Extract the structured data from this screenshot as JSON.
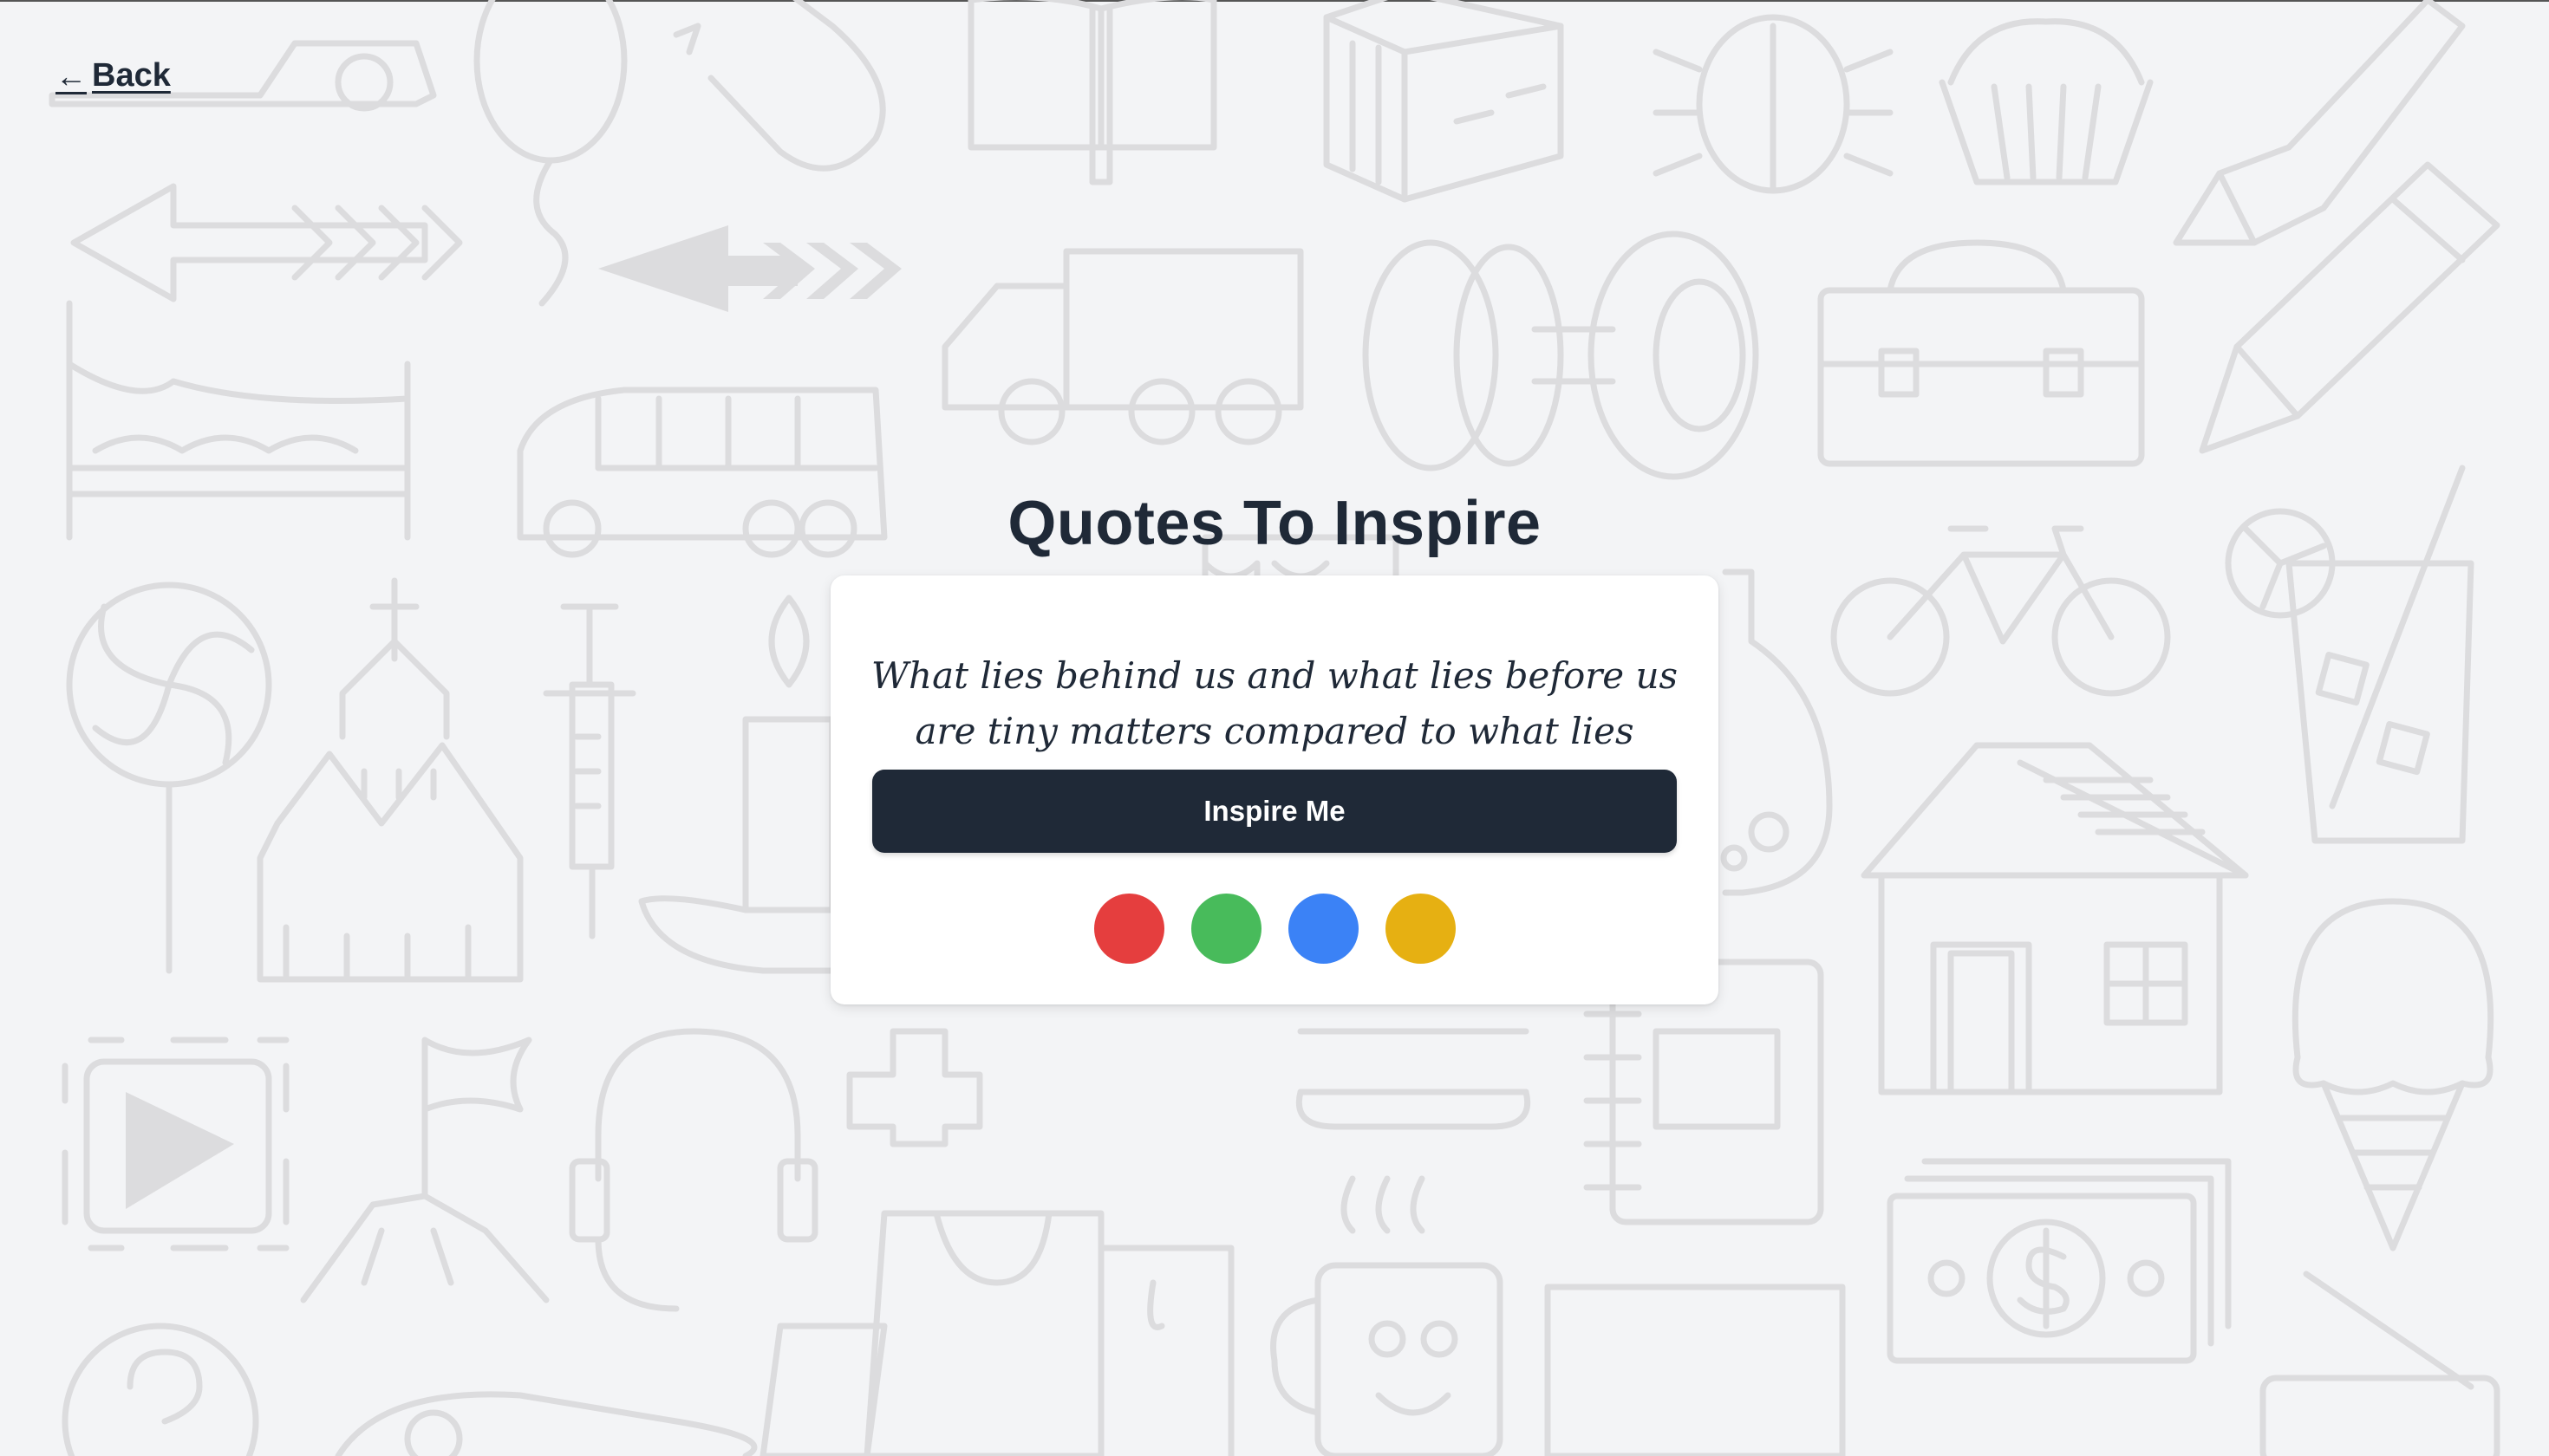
{
  "nav": {
    "back_label": "Back",
    "back_icon": "arrow-left-icon"
  },
  "page": {
    "title": "Quotes To Inspire"
  },
  "quote": {
    "text": "What lies behind us and what lies before us are tiny matters compared to what lies within us."
  },
  "actions": {
    "inspire_label": "Inspire Me"
  },
  "colors": {
    "background": "#f3f4f6",
    "doodle_stroke": "#dcdcde",
    "text": "#1f2937",
    "button": "#1f2937",
    "swatches": [
      "#e53e3e",
      "#48bb5b",
      "#3b82f6",
      "#e6b012"
    ]
  },
  "background_icons": [
    "car-icon",
    "balloon-icon",
    "magnet-icon",
    "book-icon",
    "box-icon",
    "bug-icon",
    "cupcake-icon",
    "pen-icon",
    "arrow-icon",
    "truck-icon",
    "dumbbell-icon",
    "briefcase-icon",
    "pencil-icon",
    "bed-icon",
    "bus-icon",
    "lollipop-icon",
    "church-icon",
    "syringe-icon",
    "candle-icon",
    "flask-icon",
    "bicycle-icon",
    "drink-icon",
    "house-icon",
    "play-icon",
    "flag-icon",
    "headset-icon",
    "medical-cross-icon",
    "burger-icon",
    "notebook-icon",
    "money-icon",
    "ice-cream-icon",
    "shopping-bag-icon",
    "mug-icon",
    "monitor-icon",
    "question-icon",
    "radio-icon"
  ]
}
